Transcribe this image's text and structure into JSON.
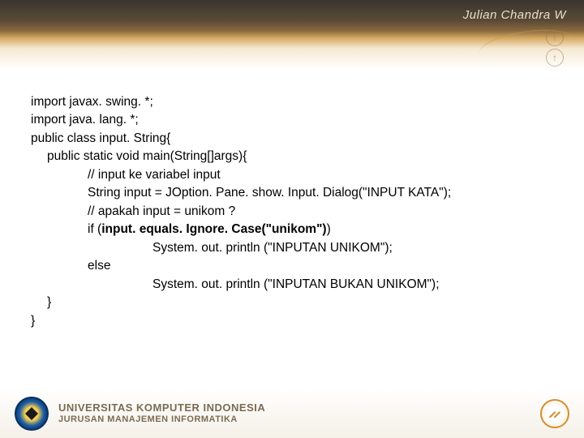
{
  "author": "Julian Chandra W",
  "code": {
    "l1": "import javax. swing. *;",
    "l2": "import java. lang. *;",
    "l3": "public class input. String{",
    "l4": "public static void main(String[]args){",
    "l5": " // input ke variabel input",
    "l6": "String input = JOption. Pane. show. Input. Dialog(\"INPUT KATA\");",
    "l7": " // apakah input = unikom ?",
    "l8a": "if (",
    "l8b": "input. equals. Ignore. Case(\"unikom\")",
    "l8c": ")",
    "l9": "System. out. println (\"INPUTAN UNIKOM\");",
    "l10": "else",
    "l11": "System. out. println (\"INPUTAN BUKAN UNIKOM\");",
    "l12": "}",
    "l13": "}"
  },
  "footer": {
    "line1": "UNIVERSITAS KOMPUTER INDONESIA",
    "line2": "JURUSAN MANAJEMEN INFORMATIKA"
  }
}
